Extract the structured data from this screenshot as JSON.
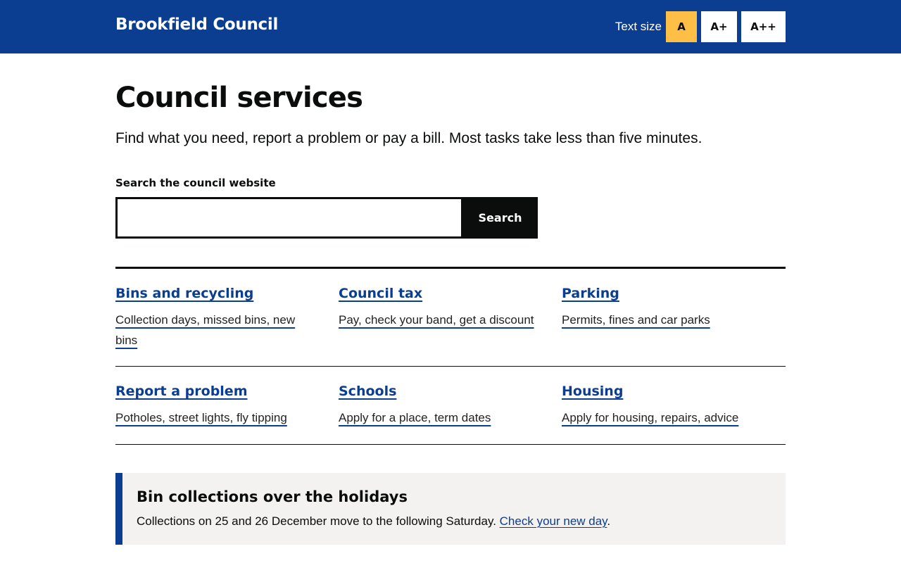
{
  "header": {
    "brand": "Brookfield Council",
    "text_size_label": "Text size",
    "text_size_options": [
      "A",
      "A+",
      "A++"
    ],
    "text_size_selected": "A"
  },
  "main": {
    "title": "Council services",
    "lead": "Find what you need, report a problem or pay a bill. Most tasks take less than five minutes.",
    "search": {
      "label": "Search the council website",
      "value": "",
      "button_label": "Search"
    },
    "services": [
      {
        "title": "Bins and recycling",
        "desc": "Collection days, missed bins, new bins"
      },
      {
        "title": "Council tax",
        "desc": "Pay, check your band, get a discount"
      },
      {
        "title": "Parking",
        "desc": "Permits, fines and car parks"
      },
      {
        "title": "Report a problem",
        "desc": "Potholes, street lights, fly tipping"
      },
      {
        "title": "Schools",
        "desc": "Apply for a place, term dates"
      },
      {
        "title": "Housing",
        "desc": "Apply for housing, repairs, advice"
      }
    ],
    "notice": {
      "title": "Bin collections over the holidays",
      "body": "Collections on 25 and 26 December move to the following Saturday.",
      "link": "Check your new day",
      "after_link": "."
    }
  },
  "colors": {
    "brand_blue": "#0b3d91",
    "active_yellow": "#ffbf47",
    "text": "#0b0c0c",
    "notice_bg": "#f3f2f1"
  }
}
